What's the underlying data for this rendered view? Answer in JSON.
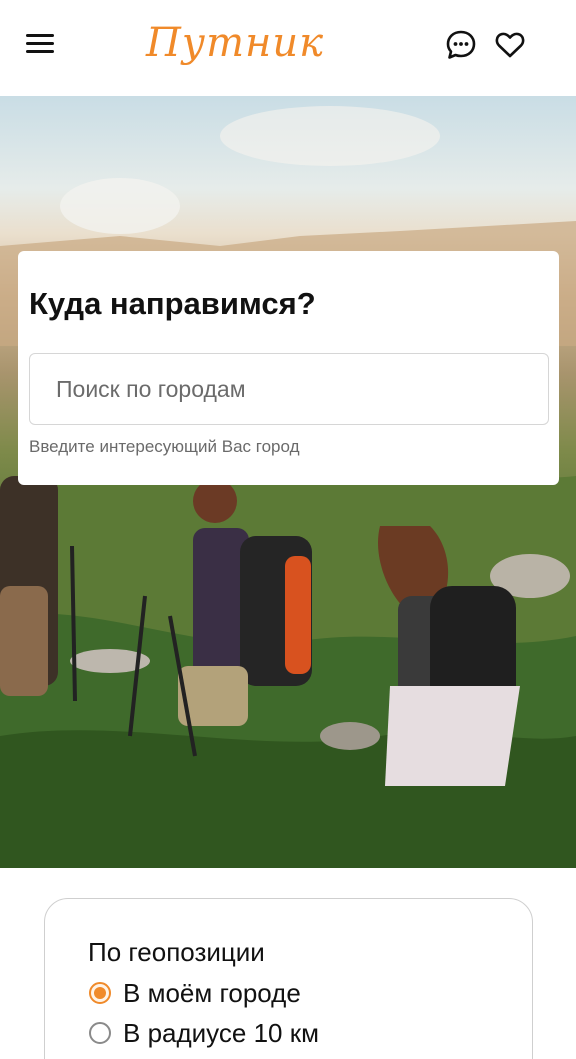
{
  "header": {
    "logo": "Путник",
    "menu_icon": "hamburger-menu-icon",
    "chat_icon": "chat-bubble-icon",
    "favorites_icon": "heart-icon"
  },
  "search": {
    "title": "Куда направимся?",
    "placeholder": "Поиск по городам",
    "value": "",
    "hint": "Введите интересующий Вас город"
  },
  "geo": {
    "title": "По геопозиции",
    "options": [
      {
        "label": "В моём городе",
        "checked": true
      },
      {
        "label": "В радиусе 10 км",
        "checked": false
      }
    ]
  },
  "colors": {
    "accent": "#f08a2a",
    "text": "#111111",
    "muted": "#6a6a6a"
  }
}
